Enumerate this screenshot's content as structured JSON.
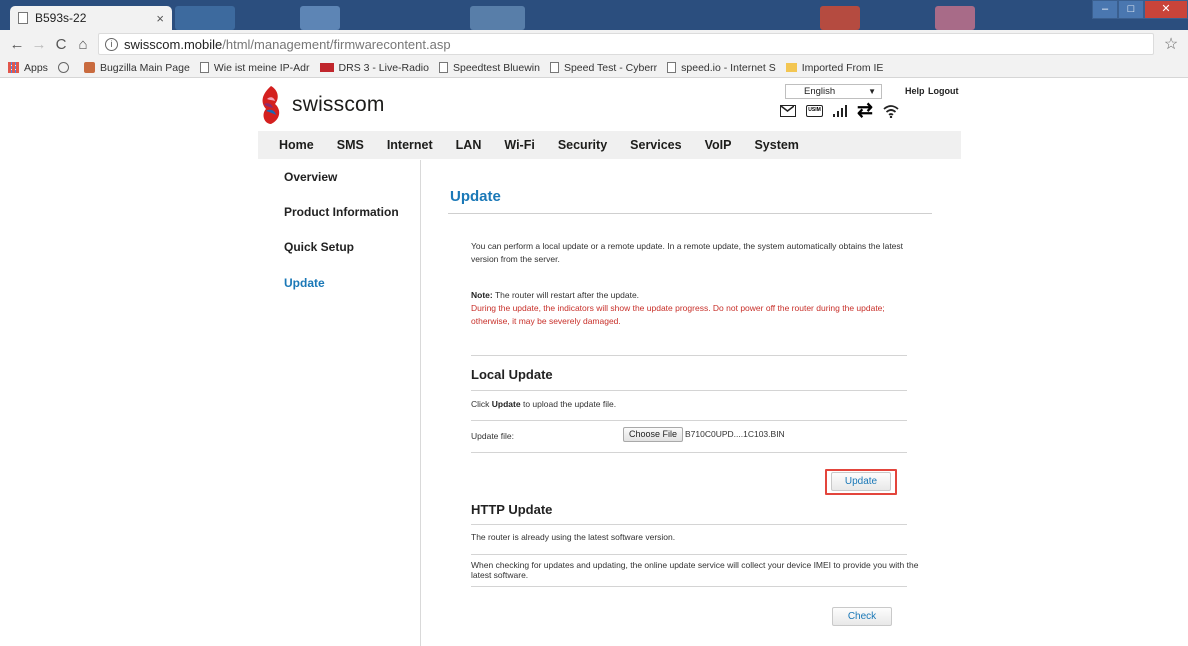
{
  "browser": {
    "tab_title": "B593s-22",
    "tab_close": "×",
    "url_host": "swisscom.mobile",
    "url_path": "/html/management/firmwarecontent.asp",
    "info_icon": "i",
    "back_icon": "←",
    "forward_icon": "→",
    "reload_icon": "C",
    "home_icon": "⌂",
    "star_icon": "☆",
    "window_controls": {
      "minimize": "–",
      "restore": "□",
      "close": "✕"
    },
    "bookmarks": [
      {
        "label": "Apps",
        "icon": "apps-grid-icon"
      },
      {
        "label": "",
        "icon": "history-icon"
      },
      {
        "label": "Bugzilla Main Page",
        "icon": "bugzilla-icon"
      },
      {
        "label": "Wie ist meine IP-Adr",
        "icon": "page-icon"
      },
      {
        "label": "DRS 3 - Live-Radio",
        "icon": "srf-icon"
      },
      {
        "label": "Speedtest Bluewin",
        "icon": "page-icon"
      },
      {
        "label": "Speed Test - Cyberr",
        "icon": "page-icon"
      },
      {
        "label": "speed.io - Internet S",
        "icon": "page-icon"
      },
      {
        "label": "Imported From IE",
        "icon": "folder-icon"
      }
    ]
  },
  "header": {
    "logo_text": "swisscom",
    "language": "English",
    "help": "Help",
    "logout": "Logout",
    "status_icons": [
      "mail-icon",
      "usim-icon",
      "signal-icon",
      "transfer-icon",
      "wifi-icon"
    ],
    "usim_label": "USIM"
  },
  "nav": {
    "items": [
      "Home",
      "SMS",
      "Internet",
      "LAN",
      "Wi-Fi",
      "Security",
      "Services",
      "VoIP",
      "System"
    ]
  },
  "sidebar": {
    "items": [
      "Overview",
      "Product Information",
      "Quick Setup",
      "Update"
    ],
    "active": "Update"
  },
  "content": {
    "title": "Update",
    "intro": "You can perform a local update or a remote update. In a remote update, the system automatically obtains the latest version from the server.",
    "note_label": "Note:",
    "note_text": " The router will restart after the update.",
    "warning": "During the update, the indicators will show the update progress. Do not power off the router during the update; otherwise, it may be severely damaged.",
    "local": {
      "heading": "Local Update",
      "instruction_prefix": "Click ",
      "instruction_bold": "Update",
      "instruction_suffix": " to upload the update file.",
      "file_label": "Update file:",
      "choose_file": "Choose File",
      "file_name": "B710C0UPD....1C103.BIN",
      "update_button": "Update"
    },
    "http": {
      "heading": "HTTP Update",
      "status": "The router is already using the latest software version.",
      "imei_notice": "When checking for updates and updating, the online update service will collect your device IMEI to provide you with the latest software.",
      "check_button": "Check"
    }
  },
  "colors": {
    "accent": "#1a78b7",
    "warning": "#c8302a",
    "highlight": "#e3453c",
    "nav_bg": "#f0f0f0"
  }
}
